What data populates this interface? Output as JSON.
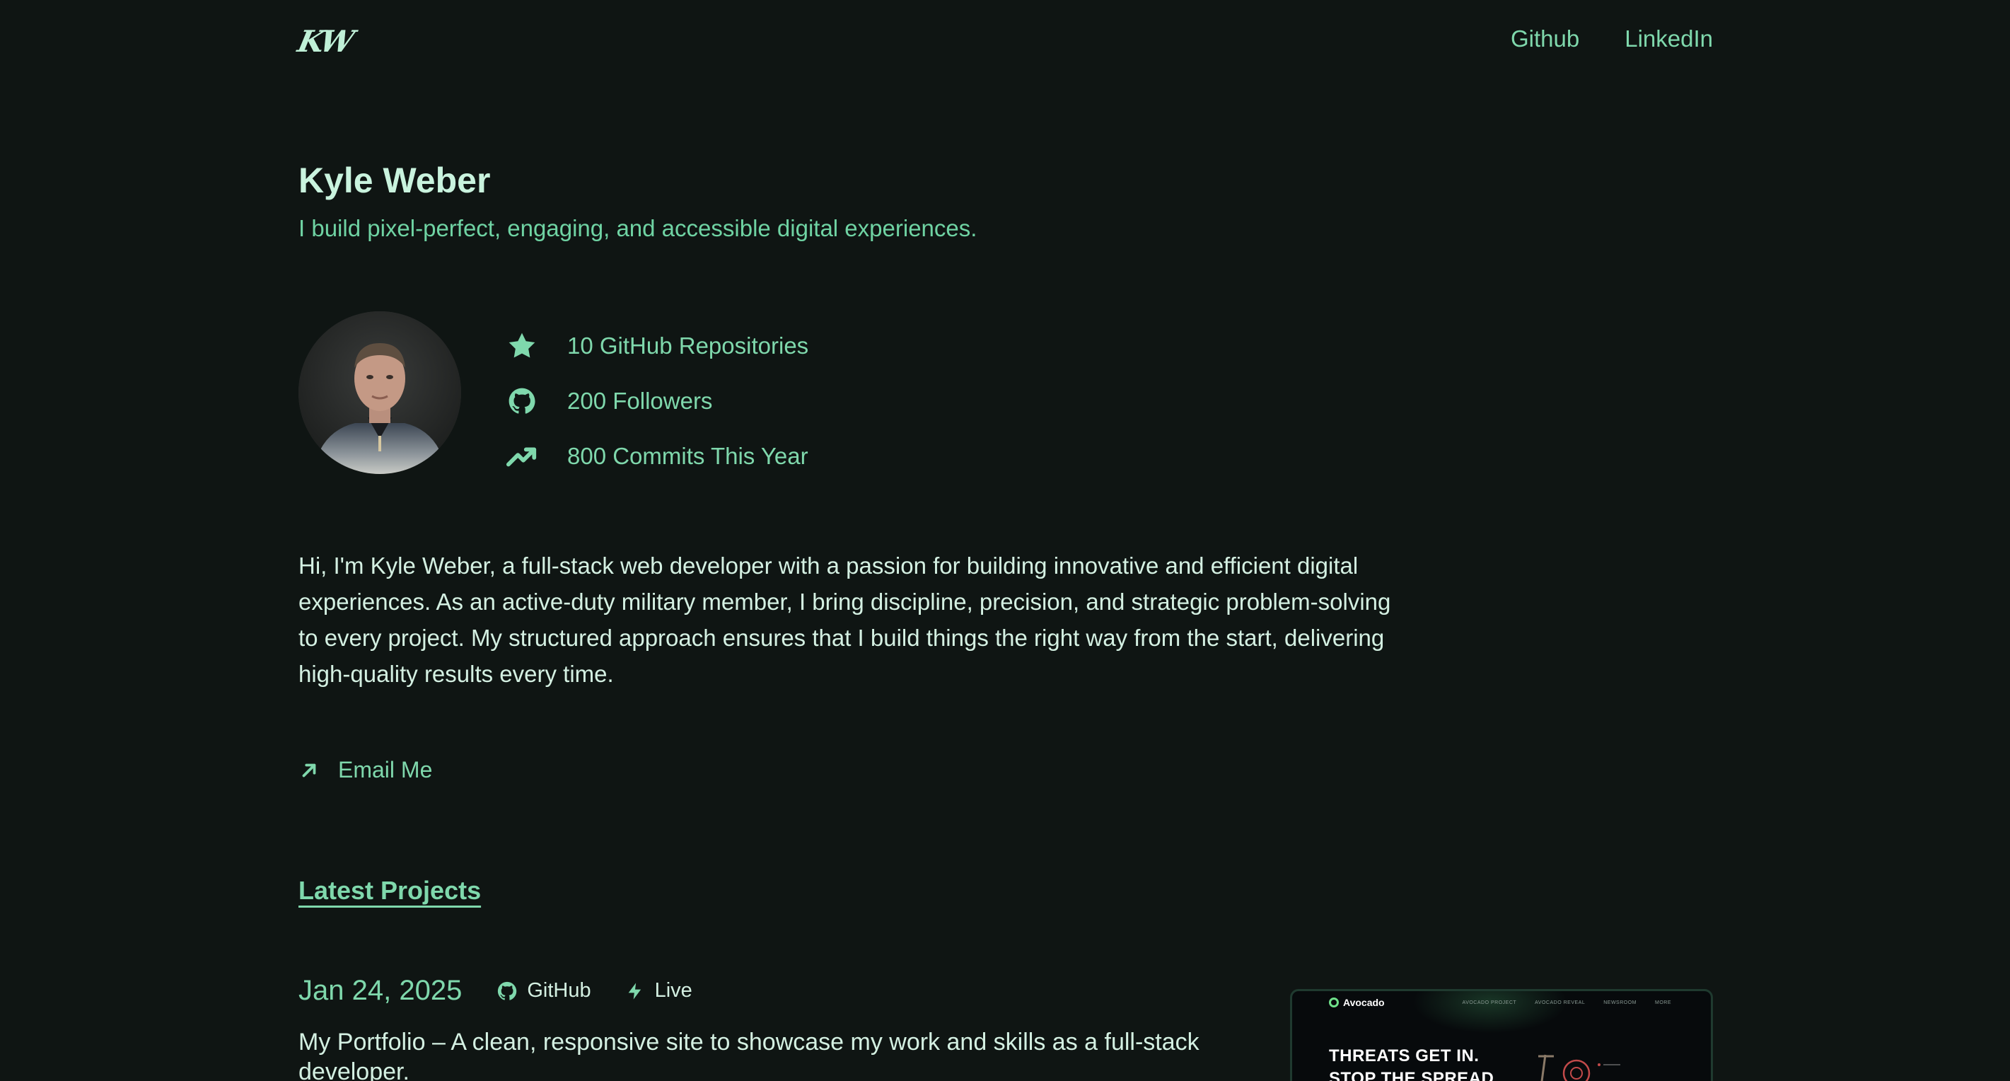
{
  "header": {
    "logo": "KW",
    "nav": [
      {
        "label": "Github"
      },
      {
        "label": "LinkedIn"
      }
    ]
  },
  "hero": {
    "name": "Kyle Weber",
    "tagline": "I build pixel-perfect, engaging, and accessible digital experiences."
  },
  "stats": [
    {
      "icon": "star-icon",
      "label": "10 GitHub Repositories"
    },
    {
      "icon": "github-icon",
      "label": "200 Followers"
    },
    {
      "icon": "trending-up-icon",
      "label": "800 Commits This Year"
    }
  ],
  "bio": "Hi, I'm Kyle Weber, a full-stack web developer with a passion for building innovative and efficient digital experiences. As an active-duty military member, I bring discipline, precision, and strategic problem-solving to every project. My structured approach ensures that I build things the right way from the start, delivering high-quality results every time.",
  "contact": {
    "icon": "arrow-up-right-icon",
    "label": "Email Me"
  },
  "projects_section": {
    "title": "Latest Projects",
    "items": [
      {
        "date": "Jan 24, 2025",
        "github_label": "GitHub",
        "live_label": "Live",
        "description": "My Portfolio – A clean, responsive site to showcase my work and skills as a full-stack developer.",
        "thumbnail": {
          "brand": "Avocado",
          "nav": [
            "AVOCADO PROJECT",
            "AVOCADO REVEAL",
            "NEWSROOM",
            "MORE"
          ],
          "headline_line1": "THREATS GET IN.",
          "headline_line2": "STOP THE SPREAD"
        }
      }
    ]
  },
  "colors": {
    "background": "#0f1513",
    "accent": "#7fd8ac",
    "heading": "#c9f3de",
    "text": "#d4f0e2"
  }
}
